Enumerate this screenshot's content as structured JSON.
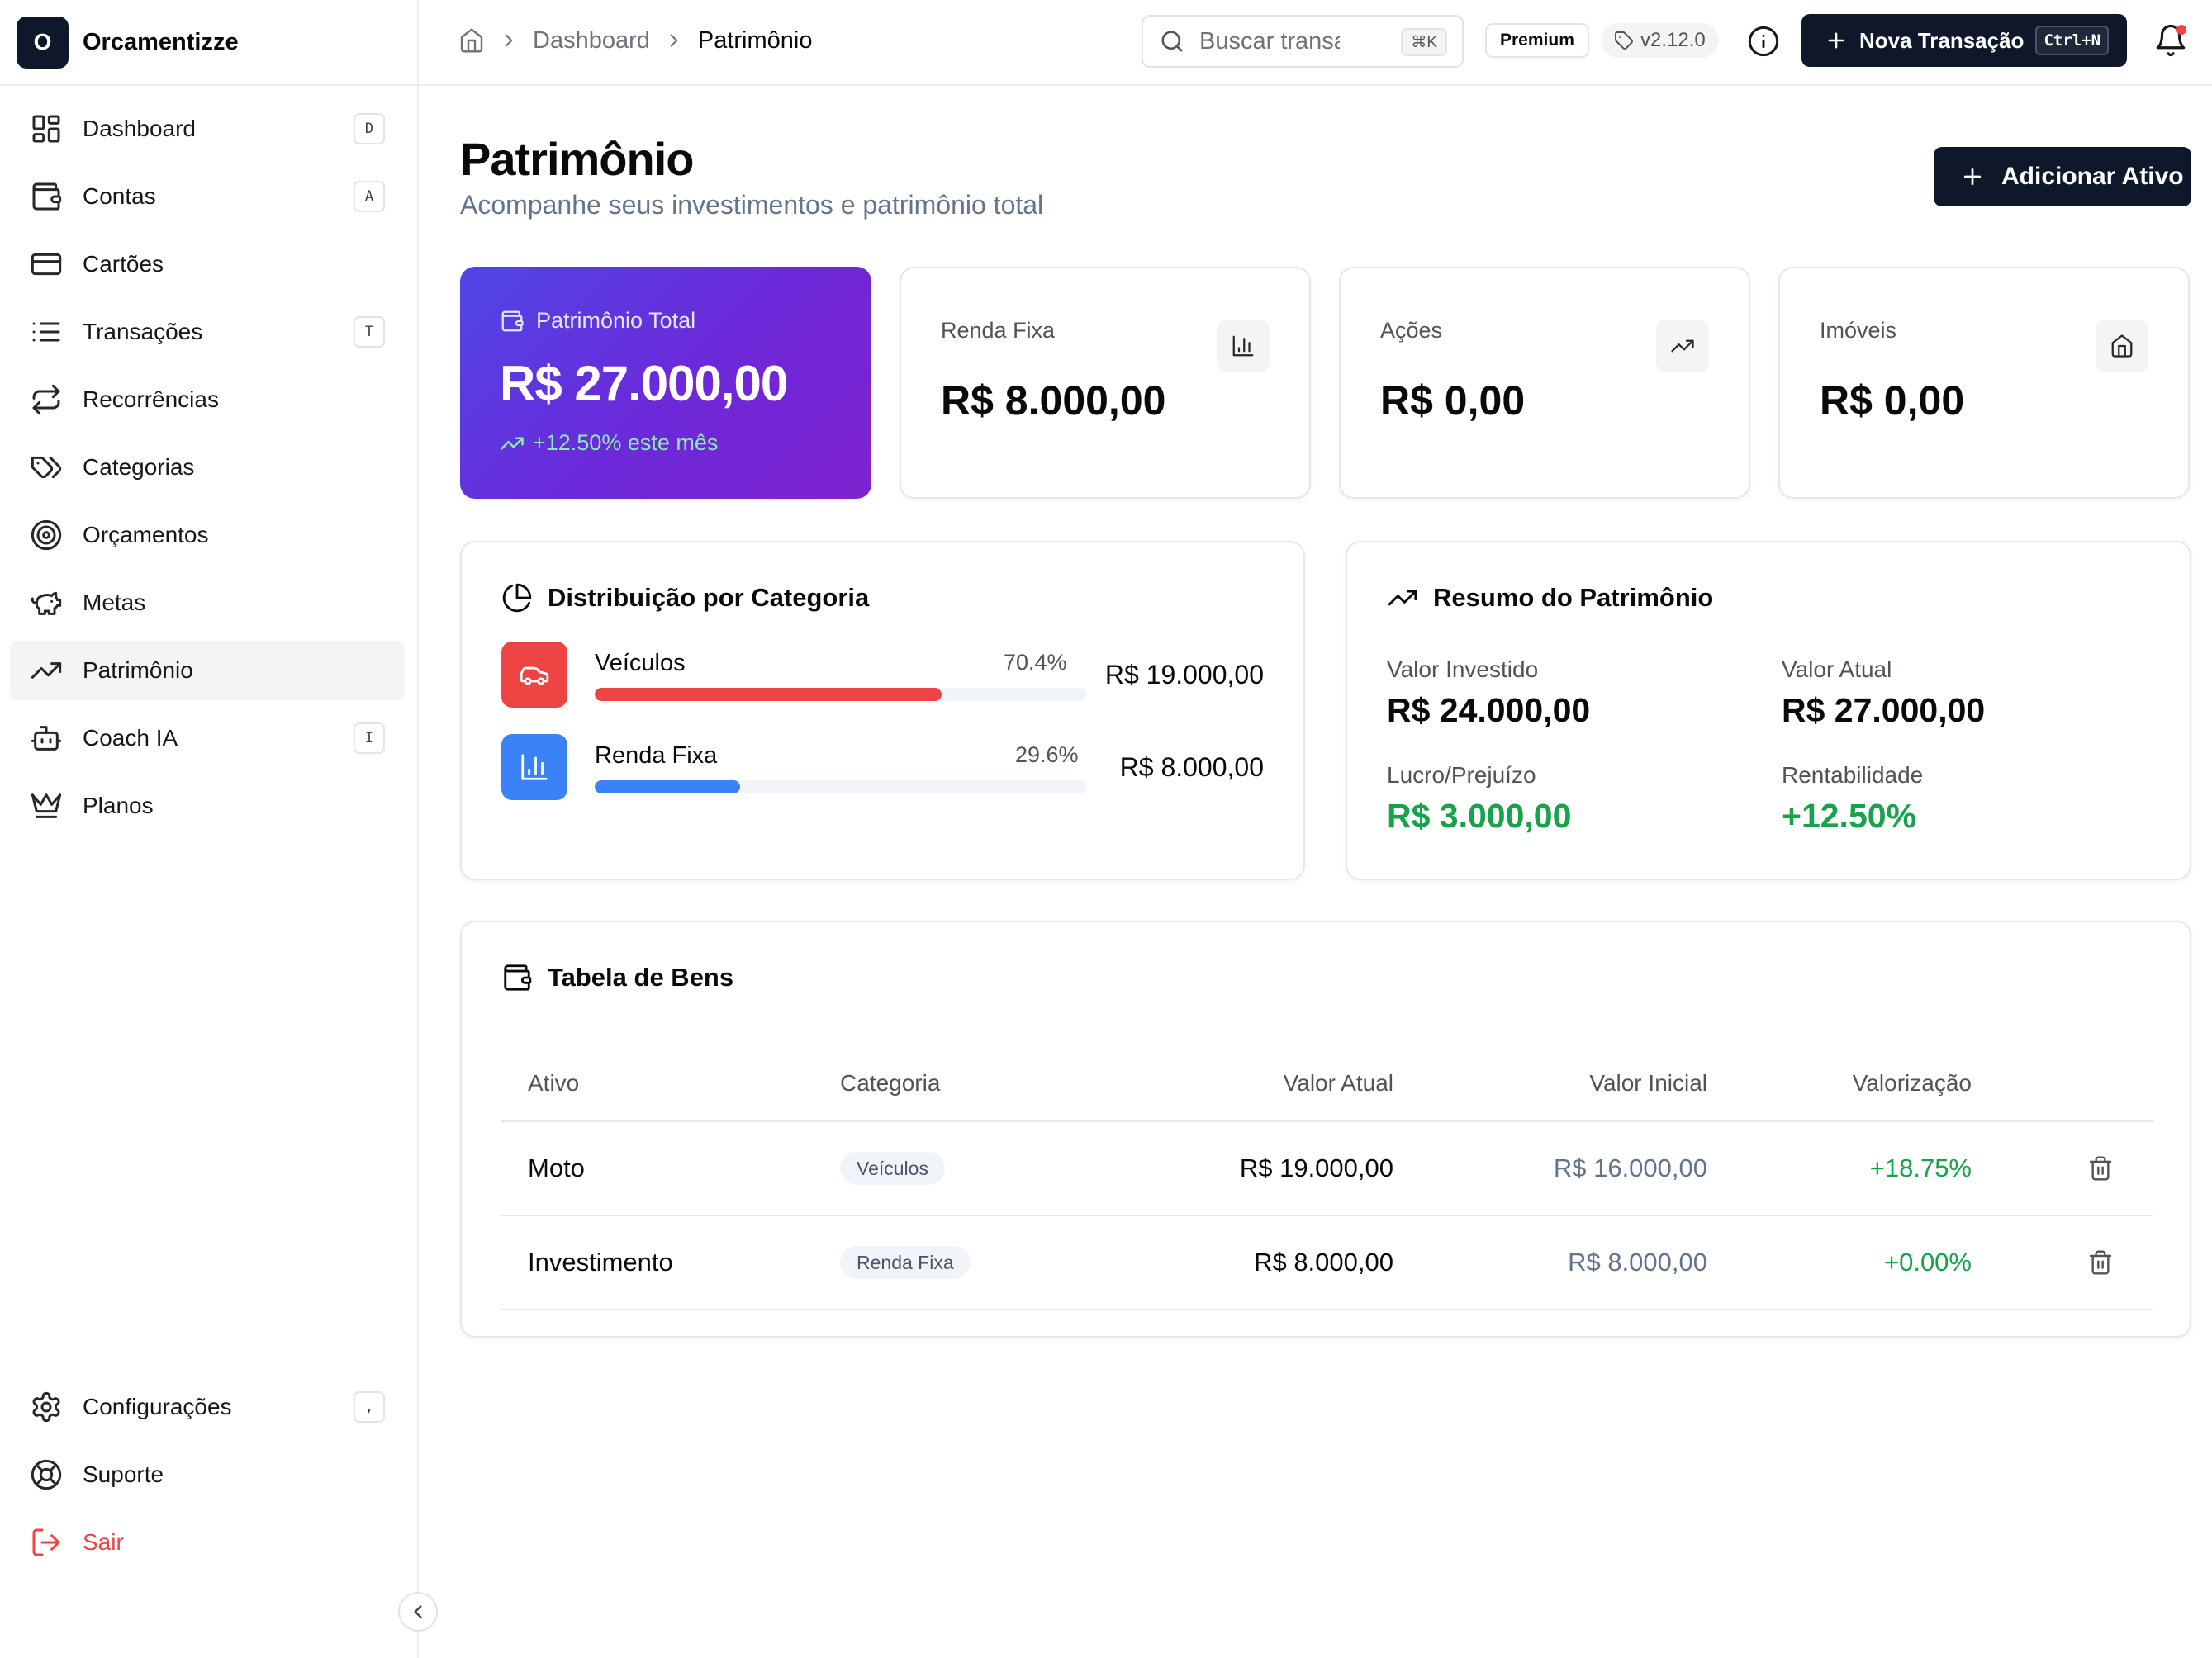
{
  "brand": {
    "logo_letter": "O",
    "name": "Orcamentizze"
  },
  "sidebar": {
    "items": [
      {
        "label": "Dashboard",
        "shortcut": "D",
        "icon": "layout-grid-icon"
      },
      {
        "label": "Contas",
        "shortcut": "A",
        "icon": "wallet-icon"
      },
      {
        "label": "Cartões",
        "shortcut": "",
        "icon": "credit-card-icon"
      },
      {
        "label": "Transações",
        "shortcut": "T",
        "icon": "list-icon"
      },
      {
        "label": "Recorrências",
        "shortcut": "",
        "icon": "repeat-icon"
      },
      {
        "label": "Categorias",
        "shortcut": "",
        "icon": "tags-icon"
      },
      {
        "label": "Orçamentos",
        "shortcut": "",
        "icon": "target-icon"
      },
      {
        "label": "Metas",
        "shortcut": "",
        "icon": "piggy-bank-icon"
      },
      {
        "label": "Patrimônio",
        "shortcut": "",
        "icon": "trending-up-icon",
        "active": true
      },
      {
        "label": "Coach IA",
        "shortcut": "I",
        "icon": "bot-icon"
      },
      {
        "label": "Planos",
        "shortcut": "",
        "icon": "crown-icon"
      }
    ],
    "bottom": [
      {
        "label": "Configurações",
        "shortcut": ",",
        "icon": "gear-icon"
      },
      {
        "label": "Suporte",
        "shortcut": "",
        "icon": "life-buoy-icon"
      },
      {
        "label": "Sair",
        "shortcut": "",
        "icon": "log-out-icon"
      }
    ]
  },
  "topbar": {
    "breadcrumb": [
      "Dashboard",
      "Patrimônio"
    ],
    "search_placeholder": "Buscar transações...",
    "search_shortcut": "⌘K",
    "plan_badge": "Premium",
    "version": "v2.12.0",
    "new_transaction_label": "Nova Transação",
    "new_transaction_shortcut": "Ctrl+N",
    "has_notification": true
  },
  "page": {
    "title": "Patrimônio",
    "subtitle": "Acompanhe seus investimentos e patrimônio total",
    "add_button": "Adicionar Ativo"
  },
  "summary_cards": {
    "total": {
      "label": "Patrimônio Total",
      "value": "R$ 27.000,00",
      "delta": "+12.50% este mês"
    },
    "renda_fixa": {
      "label": "Renda Fixa",
      "value": "R$ 8.000,00",
      "icon": "bar-chart-icon"
    },
    "acoes": {
      "label": "Ações",
      "value": "R$ 0,00",
      "icon": "trending-up-icon"
    },
    "imoveis": {
      "label": "Imóveis",
      "value": "R$ 0,00",
      "icon": "home-icon"
    }
  },
  "distribution": {
    "title": "Distribuição por Categoria",
    "items": [
      {
        "name": "Veículos",
        "percent_label": "70.4%",
        "percent": 70.4,
        "amount": "R$ 19.000,00",
        "color": "#ef4444",
        "icon": "car-icon"
      },
      {
        "name": "Renda Fixa",
        "percent_label": "29.6%",
        "percent": 29.6,
        "amount": "R$ 8.000,00",
        "color": "#3b82f6",
        "icon": "bar-chart-icon"
      }
    ]
  },
  "resumo": {
    "title": "Resumo do Patrimônio",
    "valor_investido": {
      "label": "Valor Investido",
      "value": "R$ 24.000,00"
    },
    "valor_atual": {
      "label": "Valor Atual",
      "value": "R$ 27.000,00"
    },
    "lucro": {
      "label": "Lucro/Prejuízo",
      "value": "R$ 3.000,00"
    },
    "rentabilidade": {
      "label": "Rentabilidade",
      "value": "+12.50%"
    },
    "positive_color": "#16a34a"
  },
  "tabela": {
    "title": "Tabela de Bens",
    "columns": [
      "Ativo",
      "Categoria",
      "Valor Atual",
      "Valor Inicial",
      "Valorização"
    ],
    "rows": [
      {
        "ativo": "Moto",
        "categoria": "Veículos",
        "valor_atual": "R$ 19.000,00",
        "valor_inicial": "R$ 16.000,00",
        "valorizacao": "+18.75%"
      },
      {
        "ativo": "Investimento",
        "categoria": "Renda Fixa",
        "valor_atual": "R$ 8.000,00",
        "valor_inicial": "R$ 8.000,00",
        "valorizacao": "+0.00%"
      }
    ]
  },
  "colors": {
    "primary": "#0f172a",
    "gradient_start": "#4f46e5",
    "gradient_end": "#7e22ce",
    "danger": "#ef4444"
  }
}
